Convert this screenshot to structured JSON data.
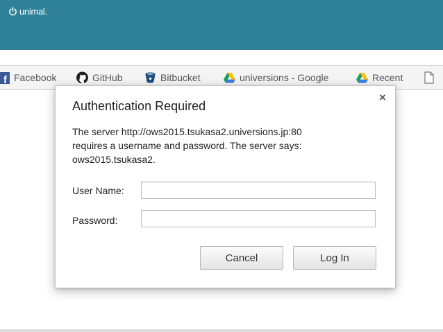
{
  "brand": {
    "name": "unimal."
  },
  "bookmarks": [
    {
      "label": "Facebook",
      "icon": "facebook-icon"
    },
    {
      "label": "GitHub",
      "icon": "github-icon"
    },
    {
      "label": "Bitbucket",
      "icon": "bitbucket-icon"
    },
    {
      "label": "universions - Google",
      "icon": "google-drive-icon"
    },
    {
      "label": "Recent",
      "icon": "google-drive-icon"
    },
    {
      "label": "",
      "icon": "document-icon"
    }
  ],
  "dialog": {
    "title": "Authentication Required",
    "close_label": "×",
    "message_lines": [
      "The server http://ows2015.tsukasa2.universions.jp:80",
      "requires a username and password. The server says:",
      "ows2015.tsukasa2."
    ],
    "username_label": "User Name:",
    "username_value": "",
    "password_label": "Password:",
    "password_value": "",
    "cancel_label": "Cancel",
    "login_label": "Log In"
  },
  "colors": {
    "header": "#2e8199",
    "facebook": "#3b5998",
    "bitbucket": "#205081",
    "bookmark_bar": "#f4f4f4"
  }
}
